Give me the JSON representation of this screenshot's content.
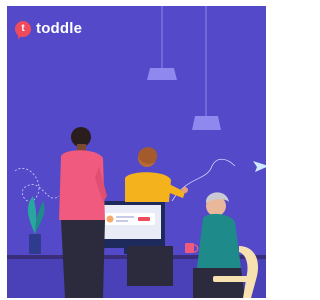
{
  "brand": {
    "name": "toddle",
    "badge_letter": "t",
    "icon": "toddle-logo-icon"
  },
  "colors": {
    "background": "#5349c9",
    "brand_red": "#f04b5d",
    "lamp": "#8f88ee",
    "pink_shirt": "#f05a7e",
    "yellow_top": "#f4b31c",
    "teal_top": "#1f8a8a",
    "chair": "#f7e1b0",
    "monitor": "#e9ecf7"
  },
  "illustration": {
    "icons": [
      "pendant-lamp-icon",
      "paper-plane-icon",
      "plant-icon",
      "monitor-icon",
      "coffee-cup-icon",
      "chair-icon"
    ]
  }
}
